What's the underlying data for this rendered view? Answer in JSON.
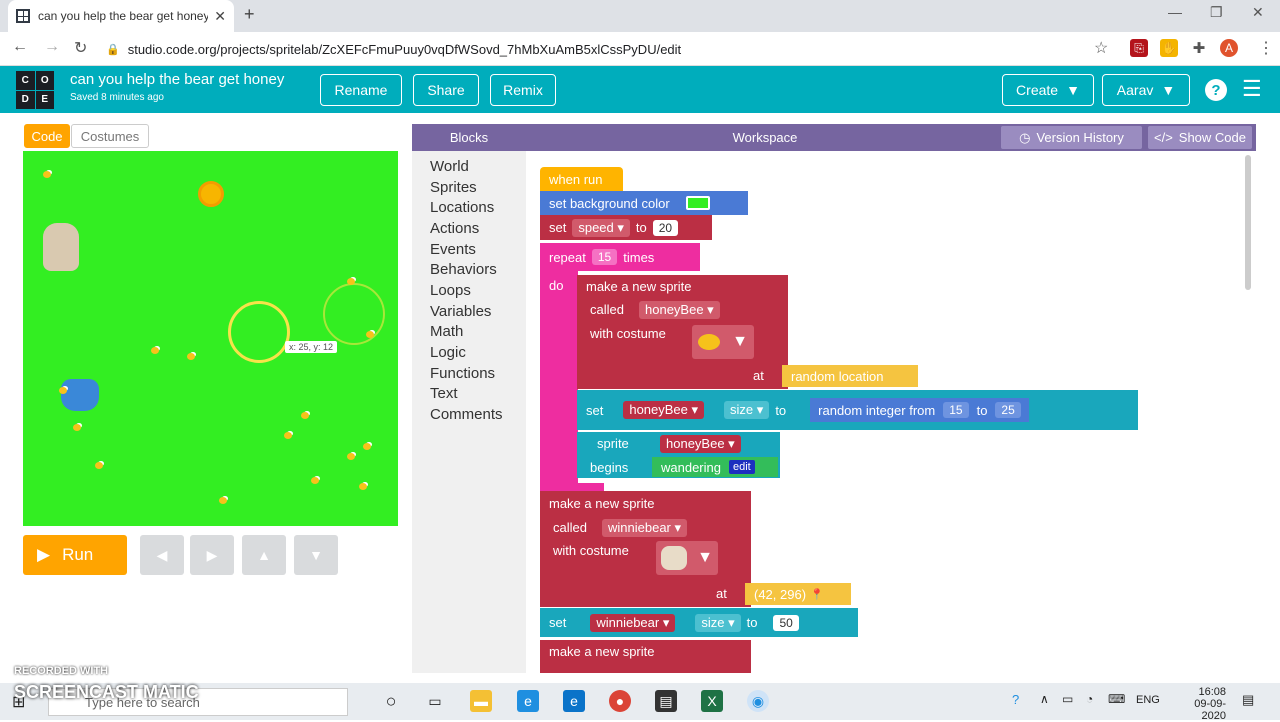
{
  "browser": {
    "tab_title": "can you help the bear get honey",
    "url": "studio.code.org/projects/spritelab/ZcXEFcFmuPuuy0vqDfWSovd_7hMbXuAmB5xlCssPyDU/edit",
    "profile_initial": "A"
  },
  "header": {
    "logo_letters": [
      "C",
      "O",
      "D",
      "E"
    ],
    "project_title": "can you help the bear get honey",
    "saved_text": "Saved 8 minutes ago",
    "buttons": [
      "Rename",
      "Share",
      "Remix"
    ],
    "create_label": "Create",
    "user_label": "Aarav",
    "help_glyph": "?"
  },
  "left_panel": {
    "tabs": [
      "Code",
      "Costumes"
    ],
    "run_label": "Run",
    "stage_label": "x: 25, y: 12"
  },
  "workspace": {
    "blocks_label": "Blocks",
    "workspace_label": "Workspace",
    "version_history": "Version History",
    "show_code": "Show Code",
    "categories": [
      "World",
      "Sprites",
      "Locations",
      "Actions",
      "Events",
      "Behaviors",
      "Loops",
      "Variables",
      "Math",
      "Logic",
      "Functions",
      "Text",
      "Comments"
    ]
  },
  "code": {
    "when_run": "when run",
    "set_bg": "set background color",
    "set": "set",
    "speed": "speed",
    "to": "to",
    "speed_value": "20",
    "repeat": "repeat",
    "repeat_count": "15",
    "times": "times",
    "do": "do",
    "make_sprite": "make a new sprite",
    "called": "called",
    "with_costume": "with costume",
    "at": "at",
    "random_location": "random location",
    "honeybee": "honeyBee",
    "size": "size",
    "random_integer": "random integer from",
    "rand_from": "15",
    "rand_to": "25",
    "sprite": "sprite",
    "begins": "begins",
    "wandering": "wandering",
    "edit": "edit",
    "winniebear": "winniebear",
    "location_value": "(42, 296)",
    "size_value": "50",
    "called_partial": "called honeyBee"
  },
  "taskbar": {
    "search_placeholder": "Type here to search",
    "lang": "ENG",
    "time": "16:08",
    "date": "09-09-2020"
  },
  "watermark": {
    "line1": "RECORDED WITH",
    "line2": "SCREENCAST MATIC"
  },
  "colors": {
    "teal": "#00adbc",
    "orange": "#ffa400",
    "purple": "#7665a0",
    "stage_green": "#33ee22",
    "event_yellow": "#ffb400",
    "world_blue": "#4a7ad5",
    "sprite_red": "#bb2f44",
    "loop_pink": "#ee2da0",
    "location_yellow": "#f5c440",
    "behavior_teal": "#19a7bc",
    "math_blue": "#4a7ad5"
  }
}
